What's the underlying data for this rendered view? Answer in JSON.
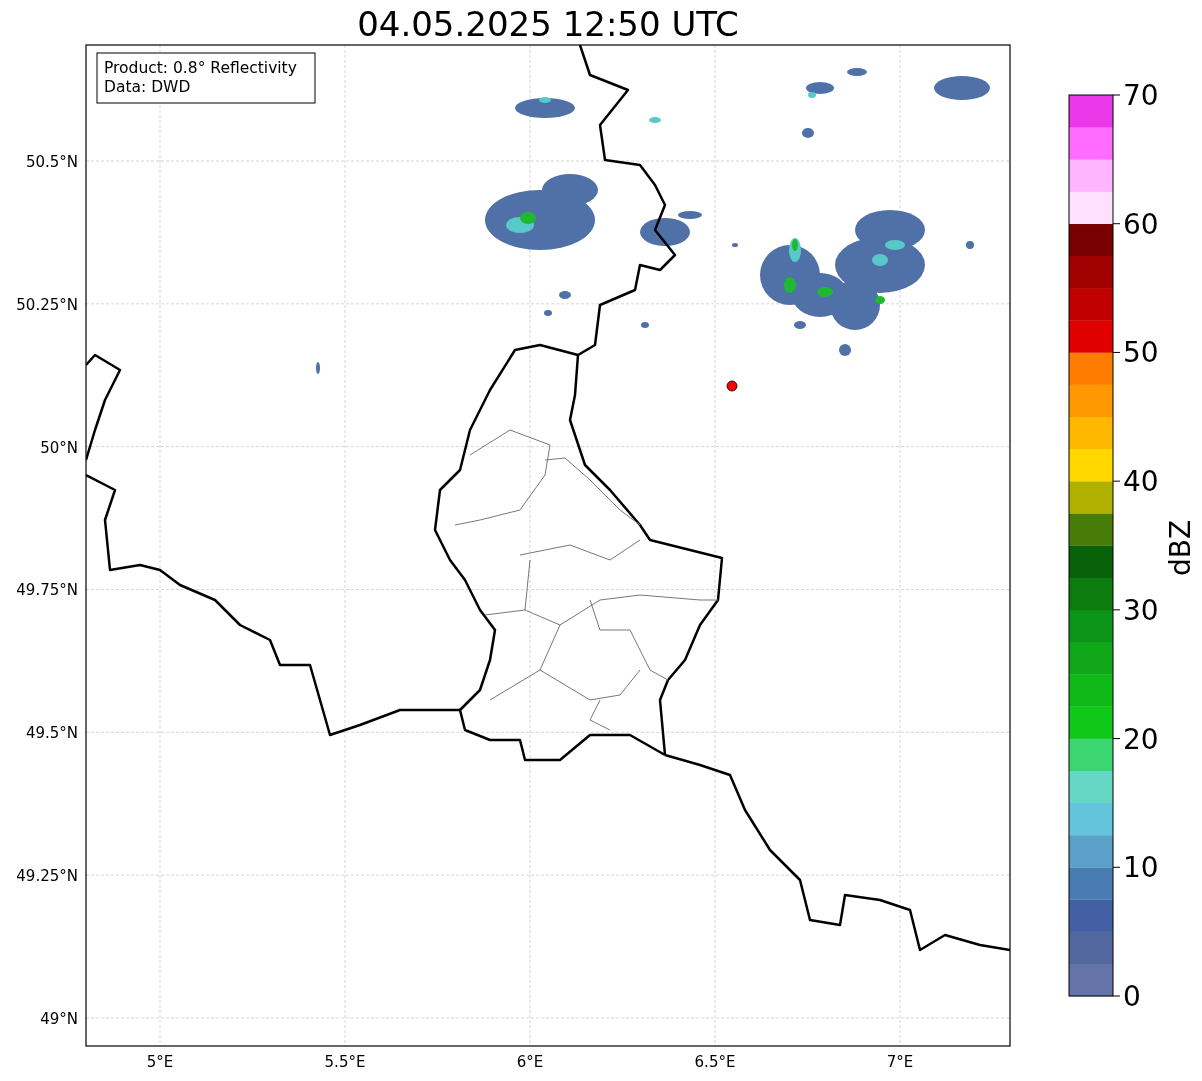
{
  "title": "04.05.2025 12:50 UTC",
  "info_box": [
    "Product: 0.8° Reflectivity",
    "Data: DWD"
  ],
  "map": {
    "lat_labels": [
      "50.5°N",
      "50.25°N",
      "50°N",
      "49.75°N",
      "49.5°N",
      "49.25°N",
      "49°N"
    ],
    "lon_labels": [
      "5°E",
      "5.5°E",
      "6°E",
      "6.5°E",
      "7°E"
    ]
  },
  "colorbar": {
    "label": "dBZ",
    "ticks": [
      "70",
      "60",
      "50",
      "40",
      "30",
      "20",
      "10",
      "0"
    ],
    "colors": [
      {
        "color": "#6474a8"
      },
      {
        "color": "#5468a0"
      },
      {
        "color": "#4460a4"
      },
      {
        "color": "#4a7cb4"
      },
      {
        "color": "#5aa0c8"
      },
      {
        "color": "#64c4dc"
      },
      {
        "color": "#64d8c4"
      },
      {
        "color": "#3cd670"
      },
      {
        "color": "#10c818"
      },
      {
        "color": "#10b818"
      },
      {
        "color": "#10a818"
      },
      {
        "color": "#0c9418"
      },
      {
        "color": "#0c7c10"
      },
      {
        "color": "#086008"
      },
      {
        "color": "#487c08"
      },
      {
        "color": "#b0b000"
      },
      {
        "color": "#ffd800"
      },
      {
        "color": "#ffb800"
      },
      {
        "color": "#ff9800"
      },
      {
        "color": "#ff7c00"
      },
      {
        "color": "#e00000"
      },
      {
        "color": "#c00000"
      },
      {
        "color": "#a00000"
      },
      {
        "color": "#780000"
      },
      {
        "color": "#ffe0ff"
      },
      {
        "color": "#ffb4ff"
      },
      {
        "color": "#ff6cff"
      },
      {
        "color": "#e838e8"
      }
    ]
  }
}
